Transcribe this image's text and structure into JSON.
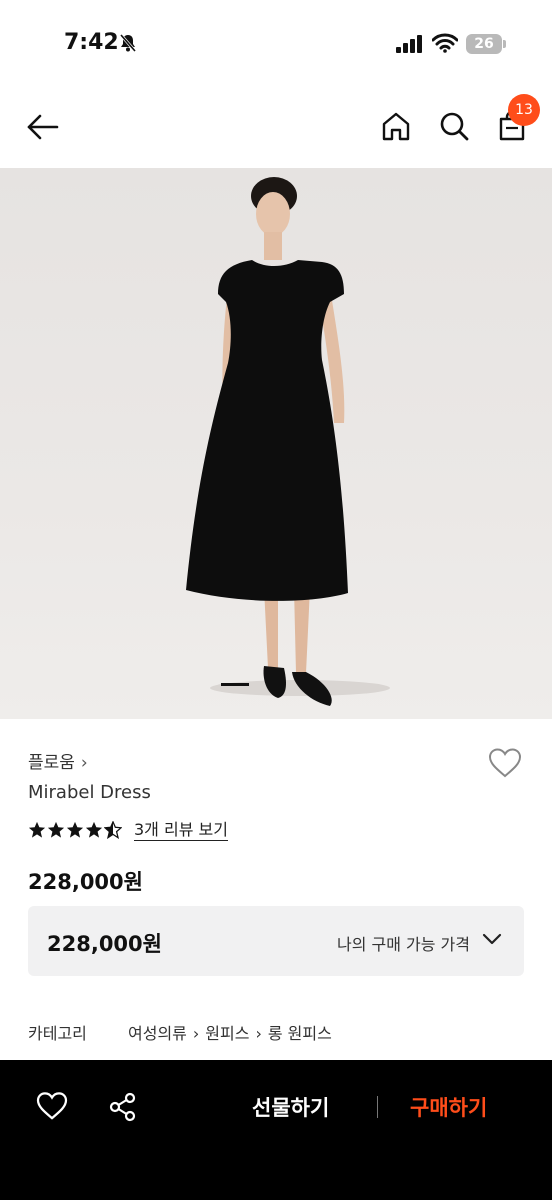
{
  "status_bar": {
    "time": "7:42",
    "battery": "26"
  },
  "header": {
    "cart_badge": "13"
  },
  "product": {
    "brand": "플로움",
    "name": "Mirabel Dress",
    "rating": 4.5,
    "review_link": "3개 리뷰 보기",
    "price": "228,000원"
  },
  "price_box": {
    "value": "228,000원",
    "label": "나의 구매 가능 가격"
  },
  "category": {
    "label": "카테고리",
    "path": [
      "여성의류",
      "원피스",
      "롱 원피스"
    ]
  },
  "bottom_bar": {
    "gift_label": "선물하기",
    "buy_label": "구매하기"
  },
  "colors": {
    "accent": "#ff4d1a",
    "bottom_bar": "#000000"
  }
}
